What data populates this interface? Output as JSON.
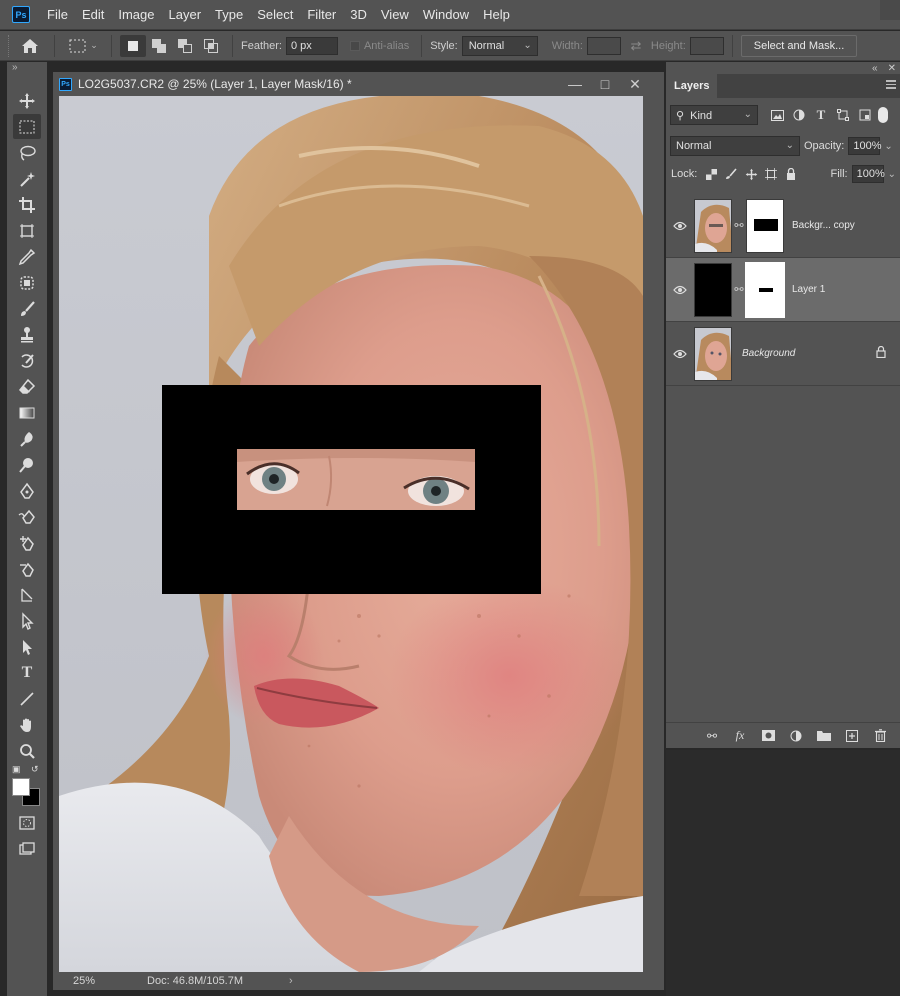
{
  "menubar": {
    "app_badge": "Ps",
    "items": [
      "File",
      "Edit",
      "Image",
      "Layer",
      "Type",
      "Select",
      "Filter",
      "3D",
      "View",
      "Window",
      "Help"
    ]
  },
  "options_bar": {
    "feather_label": "Feather:",
    "feather_value": "0 px",
    "antialias_label": "Anti-alias",
    "style_label": "Style:",
    "style_value": "Normal",
    "width_label": "Width:",
    "height_label": "Height:",
    "select_mask_label": "Select and Mask..."
  },
  "document": {
    "title": "LO2G5037.CR2 @ 25% (Layer 1, Layer Mask/16) *",
    "zoom": "25%",
    "doc_info": "Doc: 46.8M/105.7M"
  },
  "layers_panel": {
    "tab": "Layers",
    "filter_kind": "Kind",
    "blend_mode": "Normal",
    "opacity_label": "Opacity:",
    "opacity_value": "100%",
    "lock_label": "Lock:",
    "fill_label": "Fill:",
    "fill_value": "100%",
    "layers": [
      {
        "name": "Backgr... copy",
        "visible": true,
        "selected": false
      },
      {
        "name": "Layer 1",
        "visible": true,
        "selected": true
      },
      {
        "name": "Background",
        "visible": true,
        "selected": false,
        "locked": true
      }
    ]
  },
  "colors": {
    "foreground": "#ffffff",
    "background": "#000000",
    "accent": "#31a8ff"
  }
}
